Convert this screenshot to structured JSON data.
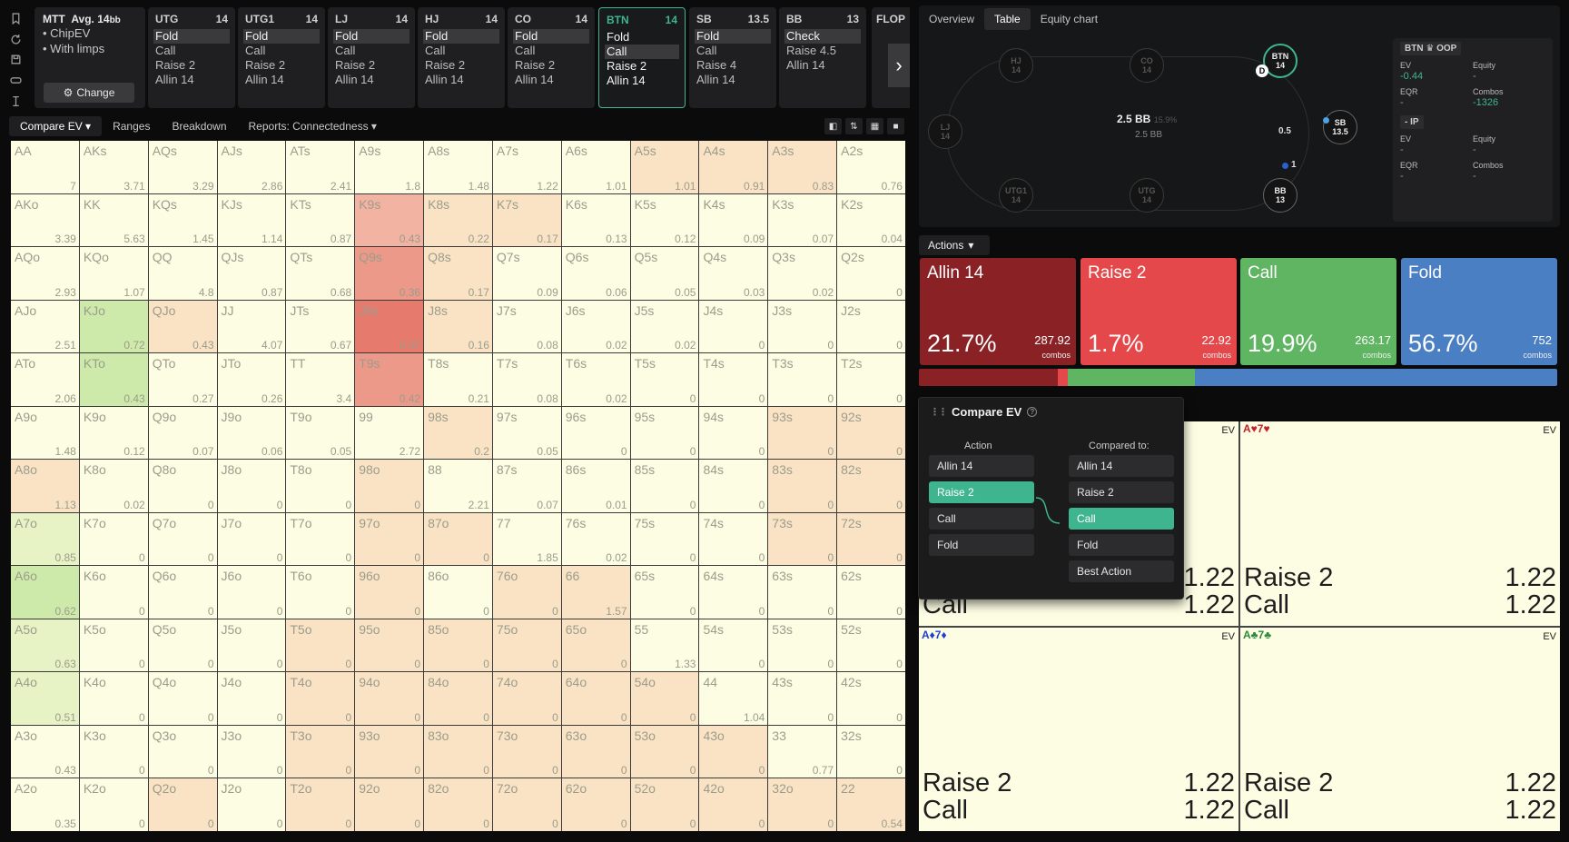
{
  "mtt": {
    "title": "MTT",
    "avg": "Avg. 14",
    "avg_suffix": "bb",
    "items": [
      "ChipEV",
      "With limps"
    ],
    "change_label": "Change"
  },
  "positions": [
    {
      "name": "UTG",
      "stack": "14",
      "actions": [
        "Fold",
        "Call",
        "Raise 2",
        "Allin 14"
      ],
      "selected": 0
    },
    {
      "name": "UTG1",
      "stack": "14",
      "actions": [
        "Fold",
        "Call",
        "Raise 2",
        "Allin 14"
      ],
      "selected": 0
    },
    {
      "name": "LJ",
      "stack": "14",
      "actions": [
        "Fold",
        "Call",
        "Raise 2",
        "Allin 14"
      ],
      "selected": 0
    },
    {
      "name": "HJ",
      "stack": "14",
      "actions": [
        "Fold",
        "Call",
        "Raise 2",
        "Allin 14"
      ],
      "selected": 0
    },
    {
      "name": "CO",
      "stack": "14",
      "actions": [
        "Fold",
        "Call",
        "Raise 2",
        "Allin 14"
      ],
      "selected": 0
    },
    {
      "name": "BTN",
      "stack": "14",
      "actions": [
        "Fold",
        "Call",
        "Raise 2",
        "Allin 14"
      ],
      "selected": 1,
      "active": true
    },
    {
      "name": "SB",
      "stack": "13.5",
      "actions": [
        "Fold",
        "Call",
        "Raise 4",
        "Allin 14"
      ],
      "selected": 0
    },
    {
      "name": "BB",
      "stack": "13",
      "actions": [
        "Check",
        "Raise 4.5",
        "Allin 14"
      ],
      "selected": 0
    }
  ],
  "flop_label": "FLOP",
  "toolbar": {
    "tabs": [
      "Compare EV",
      "Ranges",
      "Breakdown",
      "Reports: Connectedness"
    ],
    "selected": 0
  },
  "grid": {
    "names": [
      [
        "AA",
        "AKs",
        "AQs",
        "AJs",
        "ATs",
        "A9s",
        "A8s",
        "A7s",
        "A6s",
        "A5s",
        "A4s",
        "A3s",
        "A2s"
      ],
      [
        "AKo",
        "KK",
        "KQs",
        "KJs",
        "KTs",
        "K9s",
        "K8s",
        "K7s",
        "K6s",
        "K5s",
        "K4s",
        "K3s",
        "K2s"
      ],
      [
        "AQo",
        "KQo",
        "QQ",
        "QJs",
        "QTs",
        "Q9s",
        "Q8s",
        "Q7s",
        "Q6s",
        "Q5s",
        "Q4s",
        "Q3s",
        "Q2s"
      ],
      [
        "AJo",
        "KJo",
        "QJo",
        "JJ",
        "JTs",
        "J9s",
        "J8s",
        "J7s",
        "J6s",
        "J5s",
        "J4s",
        "J3s",
        "J2s"
      ],
      [
        "ATo",
        "KTo",
        "QTo",
        "JTo",
        "TT",
        "T9s",
        "T8s",
        "T7s",
        "T6s",
        "T5s",
        "T4s",
        "T3s",
        "T2s"
      ],
      [
        "A9o",
        "K9o",
        "Q9o",
        "J9o",
        "T9o",
        "99",
        "98s",
        "97s",
        "96s",
        "95s",
        "94s",
        "93s",
        "92s"
      ],
      [
        "A8o",
        "K8o",
        "Q8o",
        "J8o",
        "T8o",
        "98o",
        "88",
        "87s",
        "86s",
        "85s",
        "84s",
        "83s",
        "82s"
      ],
      [
        "A7o",
        "K7o",
        "Q7o",
        "J7o",
        "T7o",
        "97o",
        "87o",
        "77",
        "76s",
        "75s",
        "74s",
        "73s",
        "72s"
      ],
      [
        "A6o",
        "K6o",
        "Q6o",
        "J6o",
        "T6o",
        "96o",
        "86o",
        "76o",
        "66",
        "65s",
        "64s",
        "63s",
        "62s"
      ],
      [
        "A5o",
        "K5o",
        "Q5o",
        "J5o",
        "T5o",
        "95o",
        "85o",
        "75o",
        "65o",
        "55",
        "54s",
        "53s",
        "52s"
      ],
      [
        "A4o",
        "K4o",
        "Q4o",
        "J4o",
        "T4o",
        "94o",
        "84o",
        "74o",
        "64o",
        "54o",
        "44",
        "43s",
        "42s"
      ],
      [
        "A3o",
        "K3o",
        "Q3o",
        "J3o",
        "T3o",
        "93o",
        "83o",
        "73o",
        "63o",
        "53o",
        "43o",
        "33",
        "32s"
      ],
      [
        "A2o",
        "K2o",
        "Q2o",
        "J2o",
        "T2o",
        "92o",
        "82o",
        "72o",
        "62o",
        "52o",
        "42o",
        "32o",
        "22"
      ]
    ],
    "values": [
      [
        "7",
        "3.71",
        "3.29",
        "2.86",
        "2.41",
        "1.8",
        "1.48",
        "1.22",
        "1.01",
        "1.01",
        "0.91",
        "0.83",
        "0.76"
      ],
      [
        "3.39",
        "5.63",
        "1.45",
        "1.14",
        "0.87",
        "0.43",
        "0.22",
        "0.17",
        "0.13",
        "0.12",
        "0.09",
        "0.07",
        "0.04"
      ],
      [
        "2.93",
        "1.07",
        "4.8",
        "0.87",
        "0.68",
        "0.36",
        "0.17",
        "0.09",
        "0.06",
        "0.05",
        "0.03",
        "0.02",
        "0"
      ],
      [
        "2.51",
        "0.72",
        "0.43",
        "4.07",
        "0.67",
        "0.37",
        "0.16",
        "0.08",
        "0.02",
        "0.02",
        "0",
        "0",
        "0"
      ],
      [
        "2.06",
        "0.43",
        "0.27",
        "0.26",
        "3.4",
        "0.42",
        "0.21",
        "0.08",
        "0.02",
        "0",
        "0",
        "0",
        "0"
      ],
      [
        "1.48",
        "0.12",
        "0.07",
        "0.06",
        "0.05",
        "2.72",
        "0.2",
        "0.05",
        "0",
        "0",
        "0",
        "0",
        "0"
      ],
      [
        "1.13",
        "0.02",
        "0",
        "0",
        "0",
        "0",
        "2.21",
        "0.07",
        "0.01",
        "0",
        "0",
        "0",
        "0"
      ],
      [
        "0.85",
        "0",
        "0",
        "0",
        "0",
        "0",
        "0",
        "1.85",
        "0.02",
        "0",
        "0",
        "0",
        "0"
      ],
      [
        "0.62",
        "0",
        "0",
        "0",
        "0",
        "0",
        "0",
        "0",
        "1.57",
        "0",
        "0",
        "0",
        "0"
      ],
      [
        "0.63",
        "0",
        "0",
        "0",
        "0",
        "0",
        "0",
        "0",
        "0",
        "1.33",
        "0",
        "0",
        "0"
      ],
      [
        "0.51",
        "0",
        "0",
        "0",
        "0",
        "0",
        "0",
        "0",
        "0",
        "0",
        "1.04",
        "0",
        "0"
      ],
      [
        "0.43",
        "0",
        "0",
        "0",
        "0",
        "0",
        "0",
        "0",
        "0",
        "0",
        "0",
        "0.77",
        "0"
      ],
      [
        "0.35",
        "0",
        "0",
        "0",
        "0",
        "0",
        "0",
        "0",
        "0",
        "0",
        "0",
        "0",
        "0.54"
      ]
    ],
    "colors": {
      "neutral": "#fdfde4",
      "tan": "#fae3c5",
      "red_light": "#f2b3a2",
      "red_mid": "#ec9989",
      "red_dark": "#e67a6c",
      "green_light": "#e7f3c5",
      "green_mid": "#cdeaaa"
    },
    "cell_colors": [
      [
        "n",
        "n",
        "n",
        "n",
        "n",
        "n",
        "n",
        "n",
        "n",
        "t",
        "t",
        "t",
        "n"
      ],
      [
        "n",
        "n",
        "n",
        "n",
        "n",
        "rl",
        "t",
        "t",
        "n",
        "n",
        "n",
        "n",
        "n"
      ],
      [
        "n",
        "n",
        "n",
        "n",
        "n",
        "rm",
        "t",
        "n",
        "n",
        "n",
        "n",
        "n",
        "n"
      ],
      [
        "n",
        "gm",
        "t",
        "n",
        "n",
        "rd",
        "t",
        "n",
        "n",
        "n",
        "n",
        "n",
        "n"
      ],
      [
        "n",
        "gm",
        "n",
        "n",
        "n",
        "rm",
        "n",
        "n",
        "n",
        "n",
        "n",
        "n",
        "n"
      ],
      [
        "n",
        "n",
        "n",
        "n",
        "n",
        "n",
        "t",
        "n",
        "n",
        "n",
        "n",
        "t",
        "t"
      ],
      [
        "t",
        "n",
        "n",
        "n",
        "n",
        "t",
        "n",
        "n",
        "n",
        "n",
        "n",
        "t",
        "t"
      ],
      [
        "gl",
        "n",
        "n",
        "n",
        "n",
        "t",
        "t",
        "n",
        "n",
        "n",
        "n",
        "t",
        "t"
      ],
      [
        "gm",
        "n",
        "n",
        "n",
        "n",
        "t",
        "n",
        "t",
        "t",
        "n",
        "n",
        "n",
        "n"
      ],
      [
        "gl",
        "n",
        "n",
        "n",
        "t",
        "t",
        "t",
        "t",
        "t",
        "n",
        "n",
        "n",
        "n"
      ],
      [
        "gl",
        "n",
        "n",
        "n",
        "t",
        "t",
        "t",
        "t",
        "t",
        "t",
        "n",
        "n",
        "n"
      ],
      [
        "n",
        "n",
        "n",
        "n",
        "t",
        "t",
        "t",
        "t",
        "t",
        "t",
        "t",
        "n",
        "n"
      ],
      [
        "n",
        "n",
        "t",
        "n",
        "t",
        "t",
        "t",
        "t",
        "t",
        "t",
        "t",
        "t",
        "t"
      ]
    ]
  },
  "table_tabs": [
    "Overview",
    "Table",
    "Equity chart"
  ],
  "table": {
    "seats": [
      {
        "name": "HJ",
        "stack": "14"
      },
      {
        "name": "CO",
        "stack": "14"
      },
      {
        "name": "BTN",
        "stack": "14"
      },
      {
        "name": "LJ",
        "stack": "14"
      },
      {
        "name": "SB",
        "stack": "13.5"
      },
      {
        "name": "UTG1",
        "stack": "14"
      },
      {
        "name": "UTG",
        "stack": "14"
      },
      {
        "name": "BB",
        "stack": "13"
      }
    ],
    "pot": "2.5 BB",
    "pot_pct": "15.9%",
    "pot_sub": "2.5 BB",
    "sb_bet": "0.5",
    "bb_bet": "1",
    "dealer": "D"
  },
  "stats": {
    "oop": {
      "header": "BTN ♛ OOP",
      "ev_label": "EV",
      "ev": "-0.44",
      "eq_label": "Equity",
      "eq": "-",
      "eqr_label": "EQR",
      "eqr": "-",
      "combos_label": "Combos",
      "combos": "-1326"
    },
    "ip": {
      "header": "- IP",
      "ev_label": "EV",
      "ev": "-",
      "eq_label": "Equity",
      "eq": "-",
      "eqr_label": "EQR",
      "eqr": "-",
      "combos_label": "Combos",
      "combos": "-"
    }
  },
  "actions_header": "Actions",
  "actions": [
    {
      "name": "Allin 14",
      "pct": "21.7%",
      "combos": "287.92",
      "combos_label": "combos",
      "color": "#8a2125",
      "freq": 21.7
    },
    {
      "name": "Raise 2",
      "pct": "1.7%",
      "combos": "22.92",
      "combos_label": "combos",
      "color": "#e5484a",
      "freq": 1.7
    },
    {
      "name": "Call",
      "pct": "19.9%",
      "combos": "263.17",
      "combos_label": "combos",
      "color": "#5fb562",
      "freq": 19.9
    },
    {
      "name": "Fold",
      "pct": "56.7%",
      "combos": "752",
      "combos_label": "combos",
      "color": "#4b7fc4",
      "freq": 56.7
    }
  ],
  "breakdown": [
    {
      "combo": "",
      "suit_color": "#c0232b",
      "ev": "EV",
      "r1": "Raise 2",
      "v1": "1.22",
      "r2": "Call",
      "v2": "1.22"
    },
    {
      "combo": "A♥7♥",
      "suit_color": "#c0232b",
      "ev": "EV",
      "r1": "Raise 2",
      "v1": "1.22",
      "r2": "Call",
      "v2": "1.22"
    },
    {
      "combo": "A♦7♦",
      "suit_color": "#1f3fd0",
      "ev": "EV",
      "r1": "Raise 2",
      "v1": "1.22",
      "r2": "Call",
      "v2": "1.22"
    },
    {
      "combo": "A♣7♣",
      "suit_color": "#2a8a3a",
      "ev": "EV",
      "r1": "Raise 2",
      "v1": "1.22",
      "r2": "Call",
      "v2": "1.22"
    }
  ],
  "compare": {
    "title": "Compare EV",
    "help": "?",
    "action_header": "Action",
    "compared_header": "Compared to:",
    "actions": [
      "Allin 14",
      "Raise 2",
      "Call",
      "Fold"
    ],
    "action_selected": 1,
    "compared": [
      "Allin 14",
      "Raise 2",
      "Call",
      "Fold",
      "Best Action"
    ],
    "compared_selected": 2
  },
  "accent": "#3fb58f"
}
